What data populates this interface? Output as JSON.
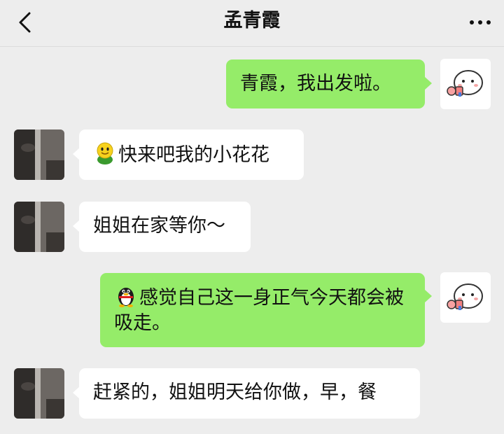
{
  "header": {
    "title": "孟青霞"
  },
  "messages": [
    {
      "side": "out",
      "text": "青霞，我出发啦。"
    },
    {
      "side": "in",
      "emoji": "smiley-emoji",
      "text": "快来吧我的小花花"
    },
    {
      "side": "in",
      "text": "姐姐在家等你～"
    },
    {
      "side": "out",
      "emoji": "qq-penguin-emoji",
      "text": "感觉自己这一身正气今天都会被吸走。"
    },
    {
      "side": "in",
      "text": "赶紧的，姐姐明天给你做，早，餐"
    }
  ],
  "colors": {
    "background": "#ededed",
    "incoming_bubble": "#ffffff",
    "outgoing_bubble": "#95ec69",
    "text": "#111111"
  },
  "icons": {
    "back": "chevron-left-icon",
    "more": "more-dots-icon",
    "self_avatar": "sticker-avatar",
    "contact_avatar": "contact-photo-avatar"
  }
}
